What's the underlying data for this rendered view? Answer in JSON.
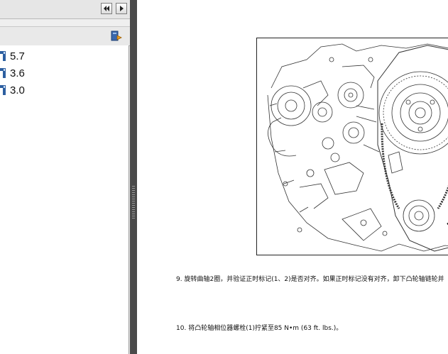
{
  "sidebar": {
    "nav_buttons": [
      {
        "icon": "double-left-arrow-icon"
      },
      {
        "icon": "right-arrow-icon"
      }
    ],
    "options_icon": "bookmark-options-icon",
    "bookmarks": [
      {
        "label": "5.7"
      },
      {
        "label": "3.6"
      },
      {
        "label": "3.0"
      }
    ]
  },
  "document": {
    "steps": [
      {
        "number": "9.",
        "text": "旋转曲轴2圈，并验证正时标记(1、2)是否对齐。如果正时标记没有对齐，卸下凸轮轴链轮并"
      },
      {
        "number": "10.",
        "text": "将凸轮轴相位器螺栓(1)拧紧至85 N•m (63 ft. lbs.)。"
      }
    ]
  },
  "colors": {
    "sidebar_bg": "#efefef",
    "splitter": "#4a4a4a",
    "bookmark_icon": "#2d5fa0"
  }
}
